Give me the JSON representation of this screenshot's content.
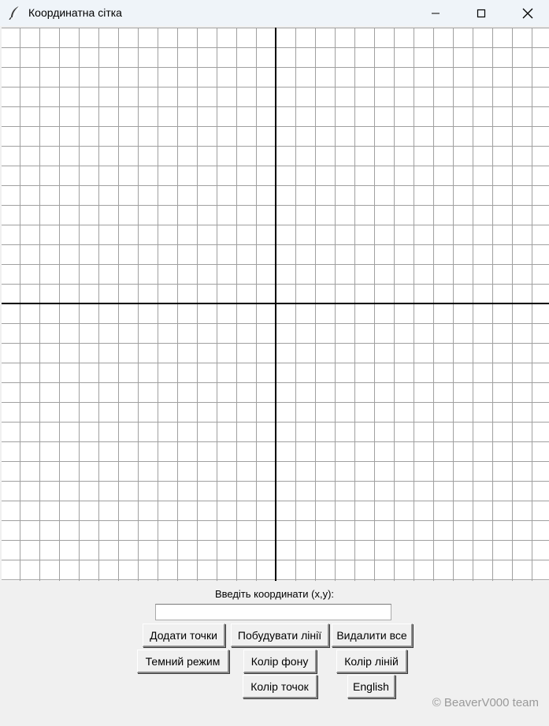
{
  "window": {
    "title": "Координатна сітка",
    "icon": "feather-icon",
    "controls": [
      "minimize-icon",
      "maximize-icon",
      "close-icon"
    ]
  },
  "grid": {
    "background": "#ffffff",
    "grid_line_color": "#a0a0a0",
    "axis_color": "#000000"
  },
  "form": {
    "prompt": "Введіть координати (x,y):",
    "input_value": "",
    "input_placeholder": ""
  },
  "buttons": {
    "add_points": "Додати точки",
    "build_lines": "Побудувати лінії",
    "delete_all": "Видалити все",
    "dark_mode": "Темний режим",
    "bg_color": "Колір фону",
    "line_color": "Колір ліній",
    "point_color": "Колір точок",
    "language": "English"
  },
  "credit": "© BeaverV000 team"
}
